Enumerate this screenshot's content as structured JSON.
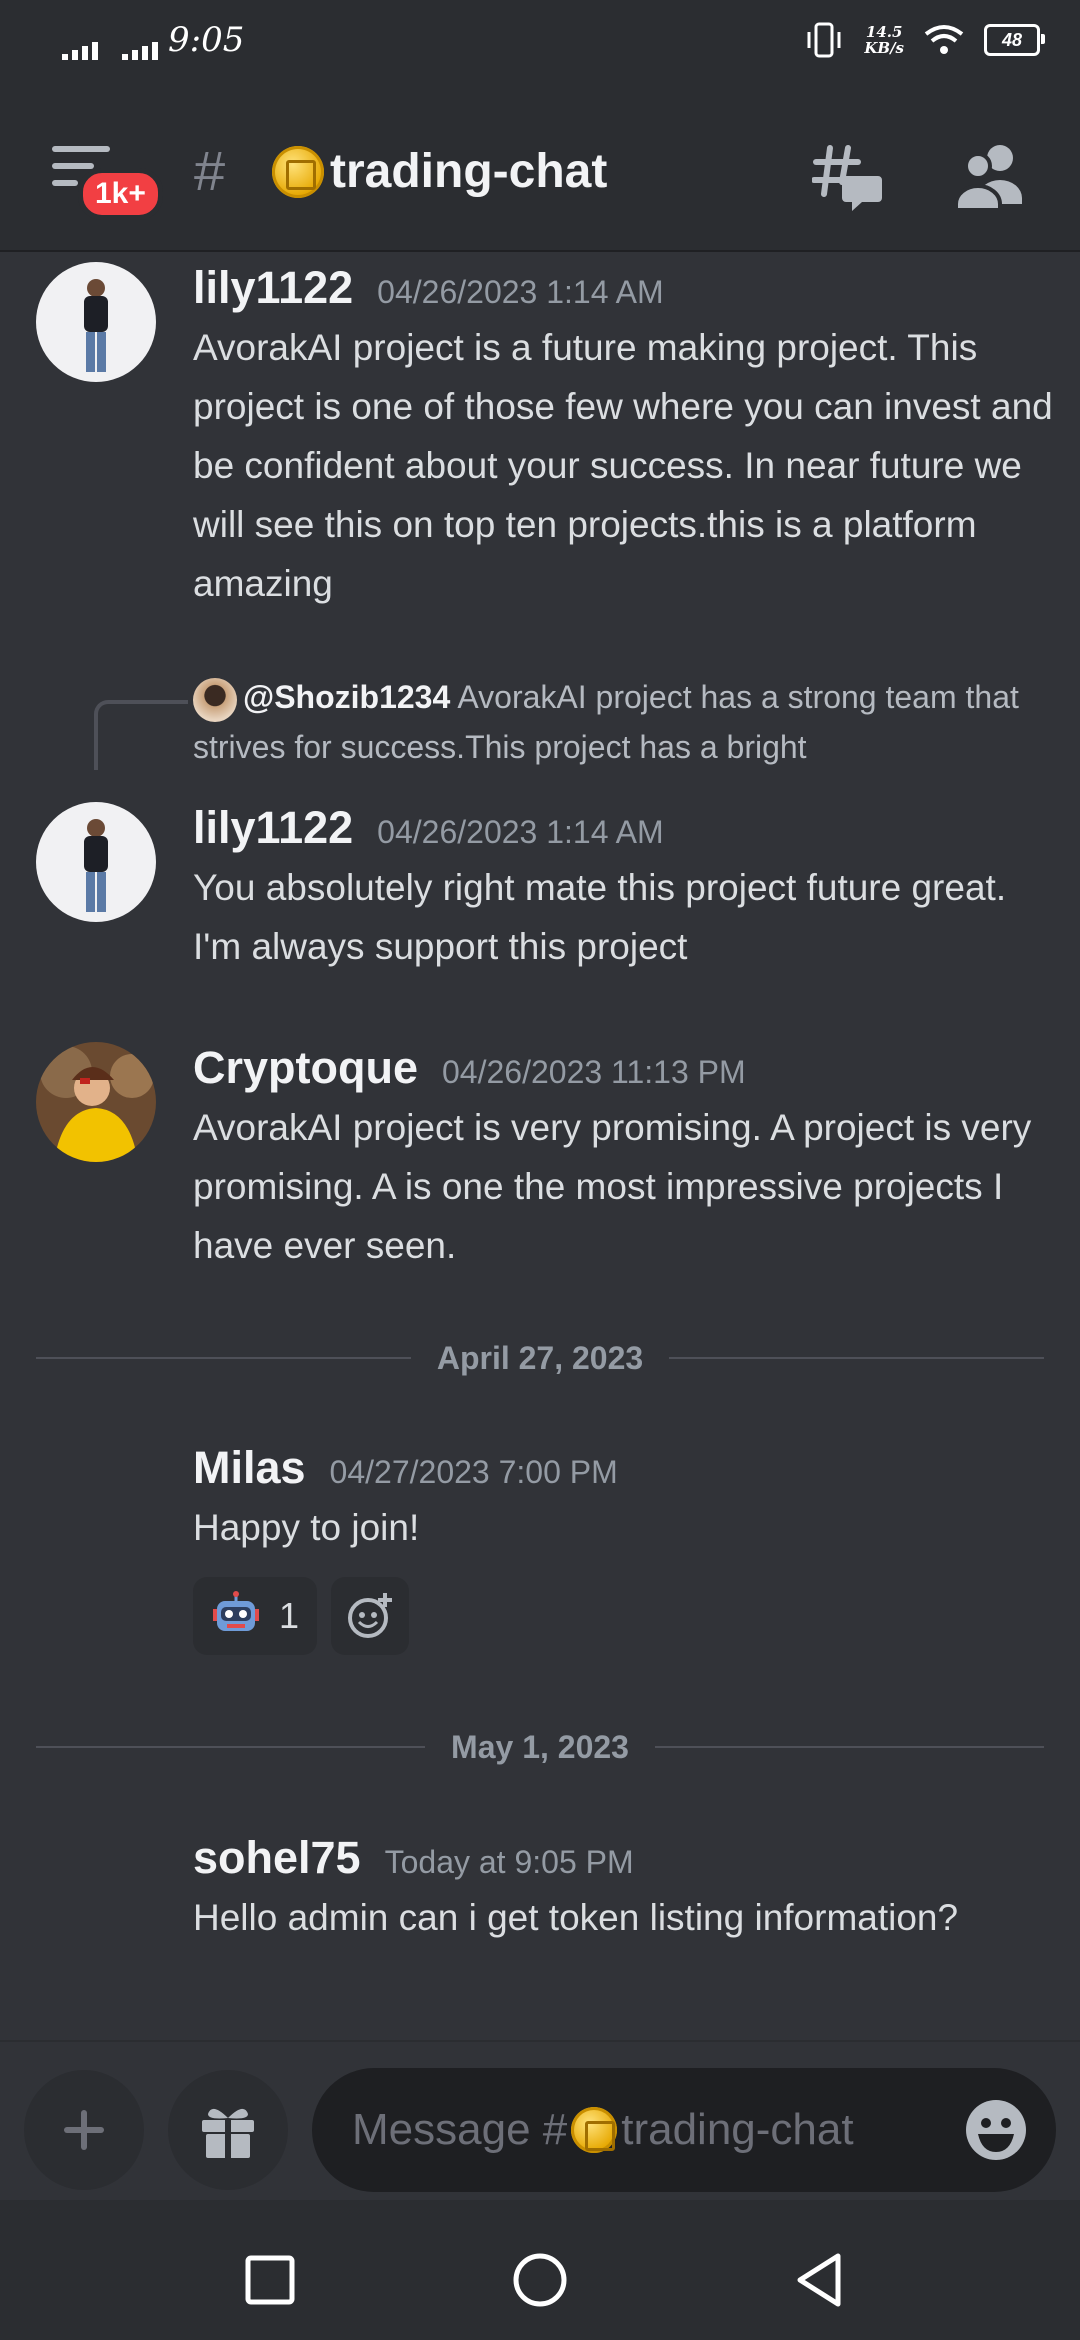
{
  "status_bar": {
    "time": "9:05",
    "speed_value": "14.5",
    "speed_unit": "KB/s",
    "battery": "48"
  },
  "header": {
    "unread_badge": "1k+",
    "hash": "#",
    "channel_name": "trading-chat"
  },
  "messages": [
    {
      "username": "lily1122",
      "timestamp": "04/26/2023 1:14 AM",
      "text": "AvorakAI project is a future making project. This project is one of those few where you can invest and be confident about your success. In near future we will see this on top ten projects.this is a platform amazing"
    },
    {
      "reply_to_user": "@Shozib1234",
      "reply_snippet": "AvorakAI project has a strong team that strives for success.This project has a bright",
      "username": "lily1122",
      "timestamp": "04/26/2023 1:14 AM",
      "text": "You absolutely right mate this project future great. I'm always support this project"
    },
    {
      "username": "Cryptoque",
      "timestamp": "04/26/2023 11:13 PM",
      "text": "AvorakAI project is very promising. A project is very promising. A is one the most impressive projects I have ever seen."
    },
    {
      "username": "Milas",
      "timestamp": "04/27/2023 7:00 PM",
      "text": "Happy to join!",
      "reaction_emoji": "robot",
      "reaction_count": "1"
    },
    {
      "username": "sohel75",
      "timestamp": "Today at 9:05 PM",
      "text": "Hello admin can i get token listing information?"
    }
  ],
  "dividers": [
    "April 27, 2023",
    "May 1, 2023"
  ],
  "composer": {
    "placeholder_prefix": "Message #",
    "placeholder_channel": "trading-chat"
  }
}
